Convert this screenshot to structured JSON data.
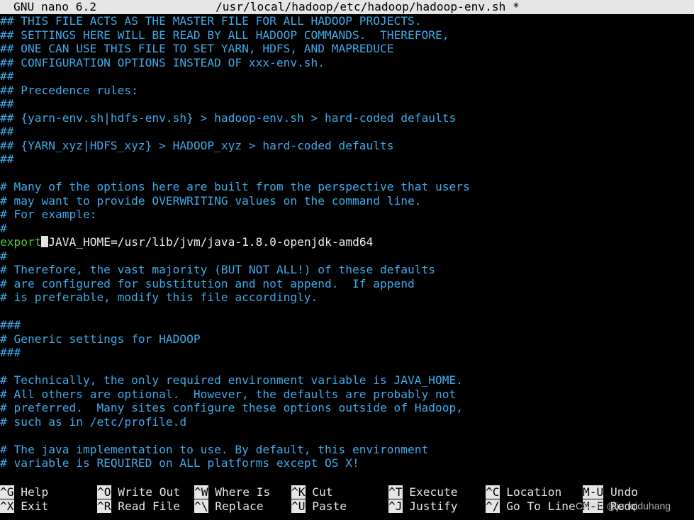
{
  "title_bar": {
    "app": "GNU nano 6.2",
    "file": "/usr/local/hadoop/etc/hadoop/hadoop-env.sh *"
  },
  "colors": {
    "comment": "#3fa9e8",
    "keyword": "#55c232",
    "text": "#ececec",
    "title_bg": "#e5e5e5",
    "background": "#000000"
  },
  "lines": [
    "## THIS FILE ACTS AS THE MASTER FILE FOR ALL HADOOP PROJECTS.",
    "## SETTINGS HERE WILL BE READ BY ALL HADOOP COMMANDS.  THEREFORE,",
    "## ONE CAN USE THIS FILE TO SET YARN, HDFS, AND MAPREDUCE",
    "## CONFIGURATION OPTIONS INSTEAD OF xxx-env.sh.",
    "##",
    "## Precedence rules:",
    "##",
    "## {yarn-env.sh|hdfs-env.sh} > hadoop-env.sh > hard-coded defaults",
    "##",
    "## {YARN_xyz|HDFS_xyz} > HADOOP_xyz > hard-coded defaults",
    "##",
    "",
    "# Many of the options here are built from the perspective that users",
    "# may want to provide OVERWRITING values on the command line.",
    "# For example:",
    "#",
    "",
    "#",
    "# Therefore, the vast majority (BUT NOT ALL!) of these defaults",
    "# are configured for substitution and not append.  If append",
    "# is preferable, modify this file accordingly.",
    "",
    "###",
    "# Generic settings for HADOOP",
    "###",
    "",
    "# Technically, the only required environment variable is JAVA_HOME.",
    "# All others are optional.  However, the defaults are probably not",
    "# preferred.  Many sites configure these options outside of Hadoop,",
    "# such as in /etc/profile.d",
    "",
    "# The java implementation to use. By default, this environment",
    "# variable is REQUIRED on ALL platforms except OS X!"
  ],
  "export_line": {
    "keyword": "export",
    "rest": "JAVA_HOME=/usr/lib/jvm/java-1.8.0-openjdk-amd64"
  },
  "shortcuts": [
    {
      "key": "^G",
      "label": "Help"
    },
    {
      "key": "^X",
      "label": "Exit"
    },
    {
      "key": "^O",
      "label": "Write Out"
    },
    {
      "key": "^R",
      "label": "Read File"
    },
    {
      "key": "^W",
      "label": "Where Is"
    },
    {
      "key": "^\\",
      "label": "Replace"
    },
    {
      "key": "^K",
      "label": "Cut"
    },
    {
      "key": "^U",
      "label": "Paste"
    },
    {
      "key": "^T",
      "label": "Execute"
    },
    {
      "key": "^J",
      "label": "Justify"
    },
    {
      "key": "^C",
      "label": "Location"
    },
    {
      "key": "^/",
      "label": "Go To Line"
    },
    {
      "key": "M-U",
      "label": "Undo"
    },
    {
      "key": "M-E",
      "label": "Redo"
    }
  ],
  "watermark": "CSDN @junqiduhang"
}
